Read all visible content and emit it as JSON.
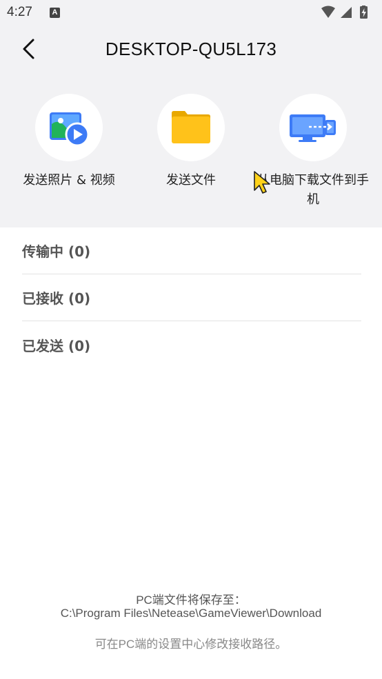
{
  "status_bar": {
    "time": "4:27",
    "notification_letter": "A",
    "icons": [
      "wifi-icon",
      "signal-icon",
      "battery-charging-icon"
    ]
  },
  "header": {
    "title": "DESKTOP-QU5L173"
  },
  "actions": [
    {
      "label": "发送照片 & 视频",
      "icon": "photo-video-icon"
    },
    {
      "label": "发送文件",
      "icon": "folder-icon"
    },
    {
      "label": "从电脑下载文件到手机",
      "icon": "pc-transfer-icon"
    }
  ],
  "sections": [
    {
      "label": "传输中 (0)"
    },
    {
      "label": "已接收 (0)"
    },
    {
      "label": "已发送 (0)"
    }
  ],
  "footer": {
    "save_to_label": "PC端文件将保存至：",
    "save_path": "C:\\Program Files\\Netease\\GameViewer\\Download",
    "hint": "可在PC端的设置中心修改接收路径。"
  },
  "colors": {
    "top_bg": "#f2f2f4",
    "accent_blue": "#3d7bf6",
    "folder_yellow": "#ffc21a",
    "photo_green": "#21b35a"
  }
}
